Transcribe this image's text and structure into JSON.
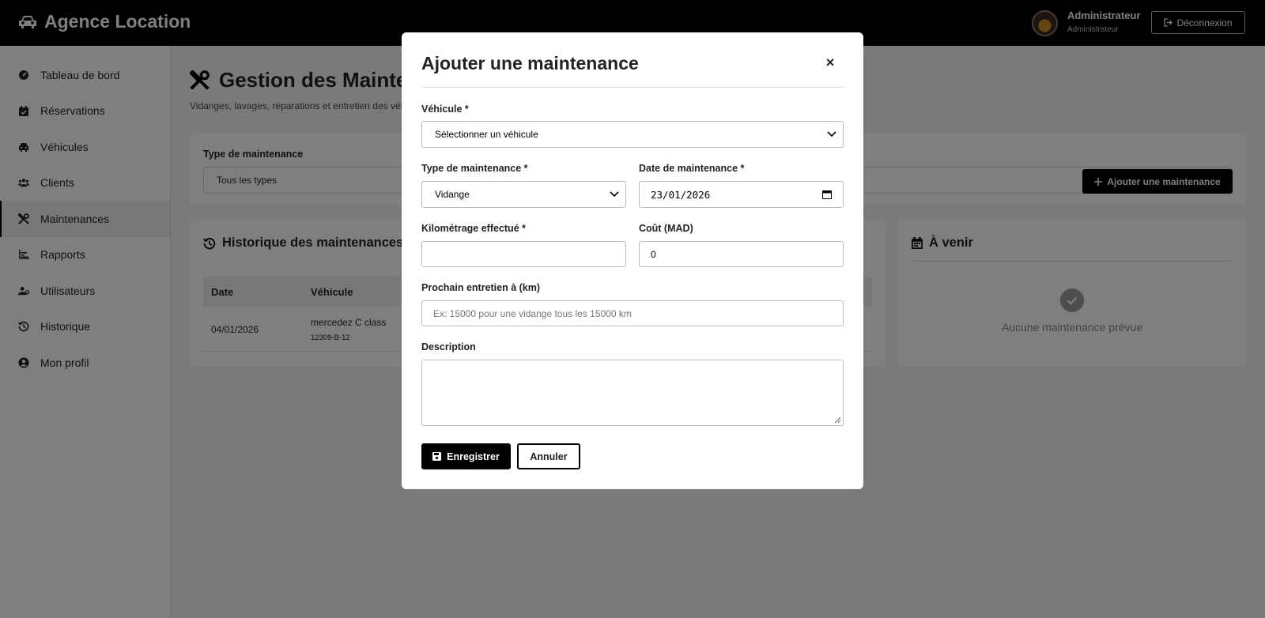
{
  "header": {
    "brand": "Agence Location",
    "user_name": "Administrateur",
    "user_role": "Administrateur",
    "logout_label": "Déconnexion"
  },
  "sidebar": {
    "items": [
      {
        "label": "Tableau de bord",
        "icon": "dashboard-icon"
      },
      {
        "label": "Réservations",
        "icon": "calendar-check-icon"
      },
      {
        "label": "Véhicules",
        "icon": "car-icon"
      },
      {
        "label": "Clients",
        "icon": "users-icon"
      },
      {
        "label": "Maintenances",
        "icon": "tools-icon"
      },
      {
        "label": "Rapports",
        "icon": "chart-icon"
      },
      {
        "label": "Utilisateurs",
        "icon": "user-cog-icon"
      },
      {
        "label": "Historique",
        "icon": "history-icon"
      },
      {
        "label": "Mon profil",
        "icon": "user-circle-icon"
      }
    ],
    "active": "Maintenances"
  },
  "main": {
    "title": "Gestion des Mainten",
    "subtitle": "Vidanges, lavages, réparations et entretien des véhi",
    "filter": {
      "type_label": "Type de maintenance",
      "type_value": "Tous les types",
      "add_button": "Ajouter une maintenance"
    },
    "history": {
      "title": "Historique des maintenances",
      "columns": [
        "Date",
        "Véhicule"
      ],
      "rows": [
        {
          "date": "04/01/2026",
          "vehicle": "mercedez C class",
          "plate": "12309-B-12"
        }
      ]
    },
    "upcoming": {
      "title": "À venir",
      "empty": "Aucune maintenance prévue"
    }
  },
  "modal": {
    "title": "Ajouter une maintenance",
    "close": "×",
    "vehicle_label": "Véhicule *",
    "vehicle_value": "Sélectionner un véhicule",
    "type_label": "Type de maintenance *",
    "type_value": "Vidange",
    "date_label": "Date de maintenance *",
    "date_value": "23/01/2026",
    "km_label": "Kilométrage effectué *",
    "km_value": "",
    "cost_label": "Coût (MAD)",
    "cost_value": "0",
    "next_label": "Prochain entretien à (km)",
    "next_placeholder": "Ex: 15000 pour une vidange tous les 15000 km",
    "desc_label": "Description",
    "desc_value": "",
    "save_label": "Enregistrer",
    "cancel_label": "Annuler"
  }
}
